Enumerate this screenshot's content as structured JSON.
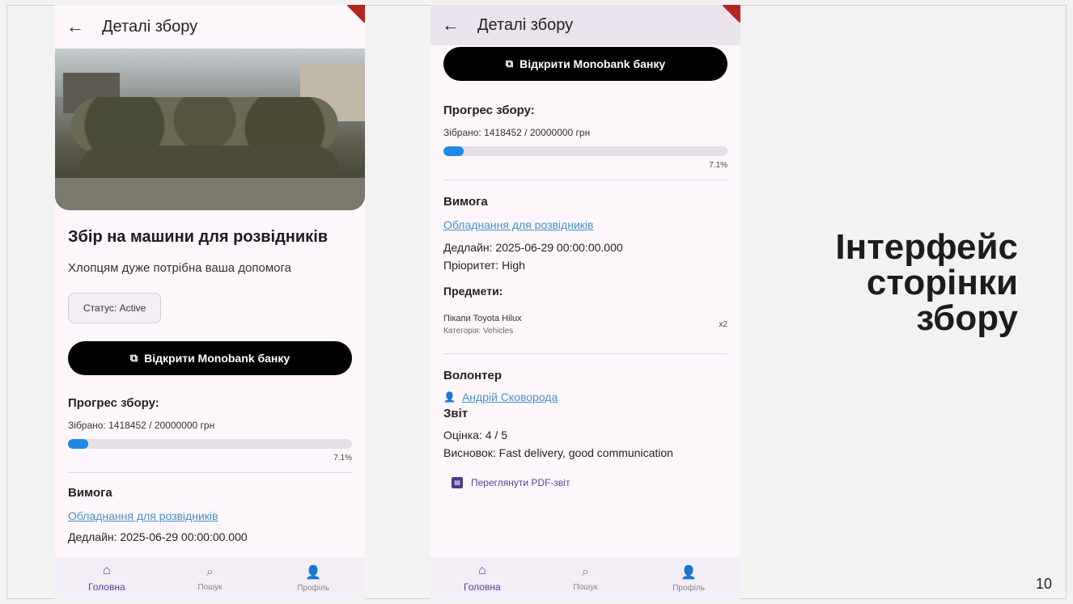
{
  "slide": {
    "heading_lines": [
      "Інтерфейс",
      "сторінки",
      "збору"
    ],
    "page_number": "10"
  },
  "appbar": {
    "title": "Деталі збору"
  },
  "campaign": {
    "title": "Збір на машини для розвідників",
    "description": "Хлопцям дуже потрібна ваша допомога",
    "status": "Статус: Active",
    "monobank_button": "Відкрити Monobank банку"
  },
  "progress": {
    "heading": "Прогрес збору:",
    "collected_text": "Зібрано: 1418452 / 20000000 грн",
    "percent_label": "7.1%",
    "fraction": 0.071
  },
  "requirement": {
    "heading": "Вимога",
    "link": "Обладнання для розвідників",
    "deadline": "Дедлайн: 2025-06-29 00:00:00.000",
    "priority": "Пріоритет: High",
    "items_heading": "Предмети:",
    "items": [
      {
        "name": "Пікапи Toyota Hilux",
        "category": "Категорія: Vehicles",
        "qty": "x2"
      }
    ]
  },
  "volunteer": {
    "heading": "Волонтер",
    "name": "Андрій Сковорода",
    "report_heading": "Звіт",
    "rating": "Оцінка: 4 / 5",
    "conclusion": "Висновок: Fast delivery, good communication",
    "pdf_button": "Переглянути PDF-звіт"
  },
  "nav": {
    "home": "Головна",
    "search": "Пошук",
    "profile": "Профіль"
  },
  "icons": {
    "back": "arrow-left-icon",
    "external": "open-external-icon",
    "home": "home-icon",
    "search": "search-icon",
    "profile": "person-icon",
    "pdf": "pdf-icon"
  },
  "colors": {
    "accent": "#5b3e9a",
    "progress": "#1e88e5",
    "link": "#4a90c8"
  }
}
